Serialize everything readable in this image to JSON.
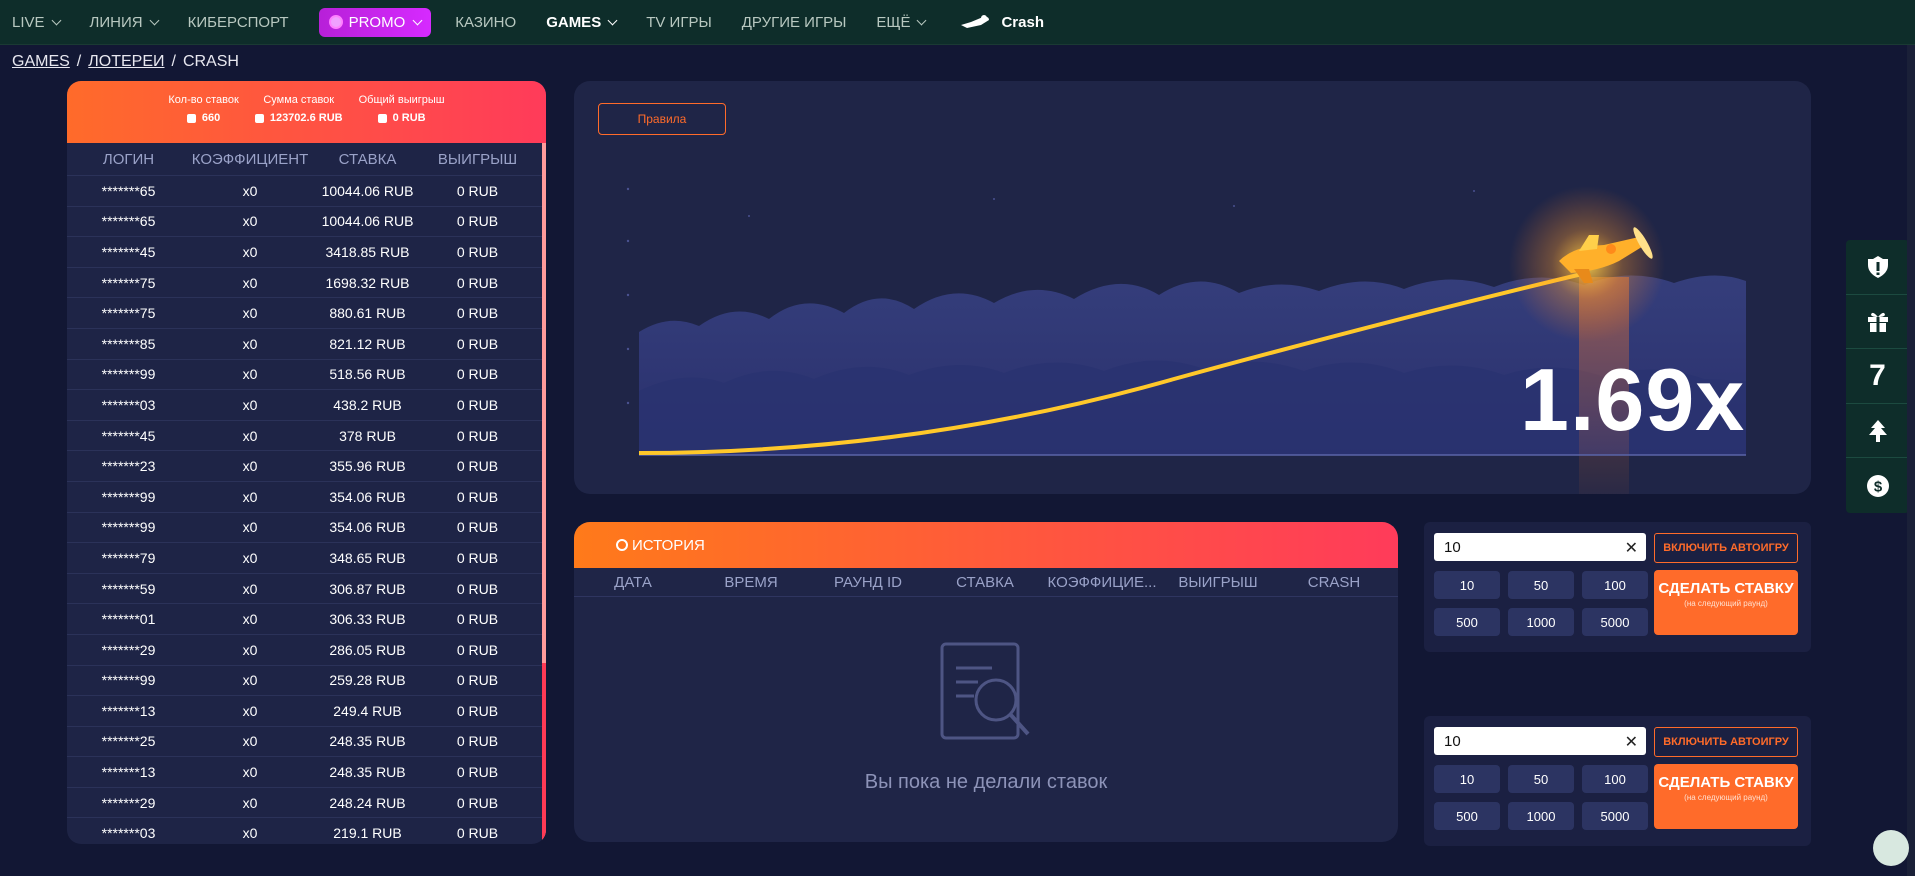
{
  "nav": {
    "items": [
      {
        "label": "LIVE",
        "chevron": true
      },
      {
        "label": "ЛИНИЯ",
        "chevron": true
      },
      {
        "label": "КИБЕРСПОРТ",
        "chevron": false
      }
    ],
    "promo": {
      "label": "PROMO"
    },
    "items2": [
      {
        "label": "КАЗИНО",
        "chevron": false
      },
      {
        "label": "GAMES",
        "chevron": true,
        "active": true
      },
      {
        "label": "TV ИГРЫ",
        "chevron": false
      },
      {
        "label": "ДРУГИЕ ИГРЫ",
        "chevron": false
      },
      {
        "label": "ЕЩЁ",
        "chevron": true
      }
    ],
    "crash_label": "Crash"
  },
  "breadcrumb": {
    "games": "GAMES",
    "lotteries": "ЛОТЕРЕИ",
    "crash": "CRASH",
    "sep": "/"
  },
  "stats": {
    "bets_count_label": "Кол-во ставок",
    "bets_count": "660",
    "bets_sum_label": "Сумма ставок",
    "bets_sum": "123702.6 RUB",
    "total_win_label": "Общий выигрыш",
    "total_win": "0 RUB"
  },
  "players_table": {
    "columns": [
      "ЛОГИН",
      "КОЭФФИЦИЕНТ",
      "СТАВКА",
      "ВЫИГРЫШ"
    ],
    "rows": [
      [
        "*******65",
        "x0",
        "10044.06 RUB",
        "0 RUB"
      ],
      [
        "*******65",
        "x0",
        "10044.06 RUB",
        "0 RUB"
      ],
      [
        "*******45",
        "x0",
        "3418.85 RUB",
        "0 RUB"
      ],
      [
        "*******75",
        "x0",
        "1698.32 RUB",
        "0 RUB"
      ],
      [
        "*******75",
        "x0",
        "880.61 RUB",
        "0 RUB"
      ],
      [
        "*******85",
        "x0",
        "821.12 RUB",
        "0 RUB"
      ],
      [
        "*******99",
        "x0",
        "518.56 RUB",
        "0 RUB"
      ],
      [
        "*******03",
        "x0",
        "438.2 RUB",
        "0 RUB"
      ],
      [
        "*******45",
        "x0",
        "378 RUB",
        "0 RUB"
      ],
      [
        "*******23",
        "x0",
        "355.96 RUB",
        "0 RUB"
      ],
      [
        "*******99",
        "x0",
        "354.06 RUB",
        "0 RUB"
      ],
      [
        "*******99",
        "x0",
        "354.06 RUB",
        "0 RUB"
      ],
      [
        "*******79",
        "x0",
        "348.65 RUB",
        "0 RUB"
      ],
      [
        "*******59",
        "x0",
        "306.87 RUB",
        "0 RUB"
      ],
      [
        "*******01",
        "x0",
        "306.33 RUB",
        "0 RUB"
      ],
      [
        "*******29",
        "x0",
        "286.05 RUB",
        "0 RUB"
      ],
      [
        "*******99",
        "x0",
        "259.28 RUB",
        "0 RUB"
      ],
      [
        "*******13",
        "x0",
        "249.4 RUB",
        "0 RUB"
      ],
      [
        "*******25",
        "x0",
        "248.35 RUB",
        "0 RUB"
      ],
      [
        "*******13",
        "x0",
        "248.35 RUB",
        "0 RUB"
      ],
      [
        "*******29",
        "x0",
        "248.24 RUB",
        "0 RUB"
      ],
      [
        "*******03",
        "x0",
        "219.1 RUB",
        "0 RUB"
      ]
    ]
  },
  "game": {
    "rules_label": "Правила",
    "multiplier": "1.69x"
  },
  "history": {
    "title": "ИСТОРИЯ",
    "columns": [
      "ДАТА",
      "ВРЕМЯ",
      "РАУНД ID",
      "СТАВКА",
      "КОЭФФИЦИЕ...",
      "ВЫИГРЫШ",
      "CRASH"
    ],
    "empty_text": "Вы пока не делали ставок"
  },
  "bet_panels": [
    {
      "input_value": "10",
      "auto_label": "ВКЛЮЧИТЬ АВТОИГРУ",
      "quick": [
        "10",
        "50",
        "100",
        "500",
        "1000",
        "5000"
      ],
      "bet_label": "СДЕЛАТЬ СТАВКУ",
      "bet_sub": "(на следующий раунд)"
    },
    {
      "input_value": "10",
      "auto_label": "ВКЛЮЧИТЬ АВТОИГРУ",
      "quick": [
        "10",
        "50",
        "100",
        "500",
        "1000",
        "5000"
      ],
      "bet_label": "СДЕЛАТЬ СТАВКУ",
      "bet_sub": "(на следующий раунд)"
    }
  ],
  "dock": {
    "seven_label": "7"
  },
  "colors": {
    "accent": "#ff6b2a",
    "brand_dark": "#0e2d2a",
    "bg": "#121734",
    "panel": "#1f2547",
    "red": "#ff3b5a"
  }
}
